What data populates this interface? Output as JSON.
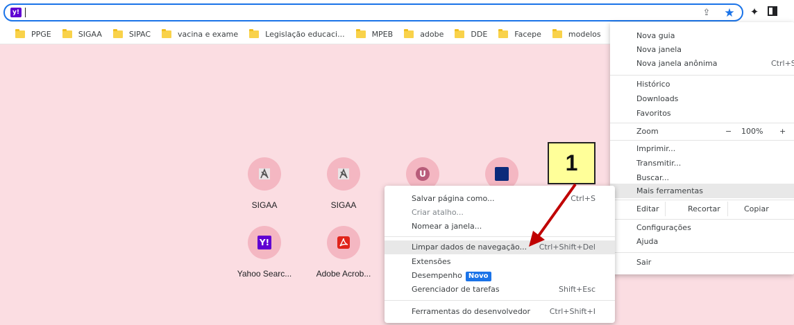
{
  "omnibox": {
    "site_icon": "yahoo-icon",
    "site_icon_text": "y!"
  },
  "toolbar": {
    "icons": [
      "share-icon",
      "star-icon",
      "extensions-icon",
      "side-panel-icon"
    ]
  },
  "bookmarks": [
    "PPGE",
    "SIGAA",
    "SIPAC",
    "vacina e exame",
    "Legislação educaci...",
    "MPEB",
    "adobe",
    "DDE",
    "Facepe",
    "modelos"
  ],
  "shortcuts": [
    {
      "label": "SIGAA",
      "icon": "sigaa-icon"
    },
    {
      "label": "SIGAA",
      "icon": "sigaa-icon"
    },
    {
      "label": "",
      "icon": "u-icon",
      "glyph": "U"
    },
    {
      "label": "",
      "icon": "blue-square-icon"
    },
    {
      "label": "Yahoo Searc...",
      "icon": "yahoo-icon",
      "glyph": "Y!"
    },
    {
      "label": "Adobe Acrob...",
      "icon": "adobe-acrobat-icon"
    }
  ],
  "main_menu": {
    "nova_guia": "Nova guia",
    "nova_janela": "Nova janela",
    "nova_janela_anonima": "Nova janela anônima",
    "anonima_shortcut": "Ctrl+S",
    "historico": "Histórico",
    "downloads": "Downloads",
    "favoritos": "Favoritos",
    "zoom": "Zoom",
    "zoom_minus": "−",
    "zoom_value": "100%",
    "zoom_plus": "+",
    "imprimir": "Imprimir...",
    "transmitir": "Transmitir...",
    "buscar": "Buscar...",
    "mais_ferramentas": "Mais ferramentas",
    "editar": "Editar",
    "recortar": "Recortar",
    "copiar": "Copiar",
    "configuracoes": "Configurações",
    "ajuda": "Ajuda",
    "sair": "Sair"
  },
  "submenu": {
    "salvar": "Salvar página como...",
    "salvar_sc": "Ctrl+S",
    "criar_atalho": "Criar atalho...",
    "nomear_janela": "Nomear a janela...",
    "limpar": "Limpar dados de navegação...",
    "limpar_sc": "Ctrl+Shift+Del",
    "extensoes": "Extensões",
    "desempenho": "Desempenho",
    "novo_badge": "Novo",
    "gerenciador": "Gerenciador de tarefas",
    "gerenciador_sc": "Shift+Esc",
    "ferramentas_dev": "Ferramentas do desenvolvedor",
    "ferramentas_dev_sc": "Ctrl+Shift+I"
  },
  "annotation": {
    "label": "1",
    "color": "#ffff99",
    "arrow_color": "#c00000"
  },
  "colors": {
    "page_bg": "#fbdde2",
    "accent": "#1a73e8",
    "highlight": "#e8e8e8"
  }
}
